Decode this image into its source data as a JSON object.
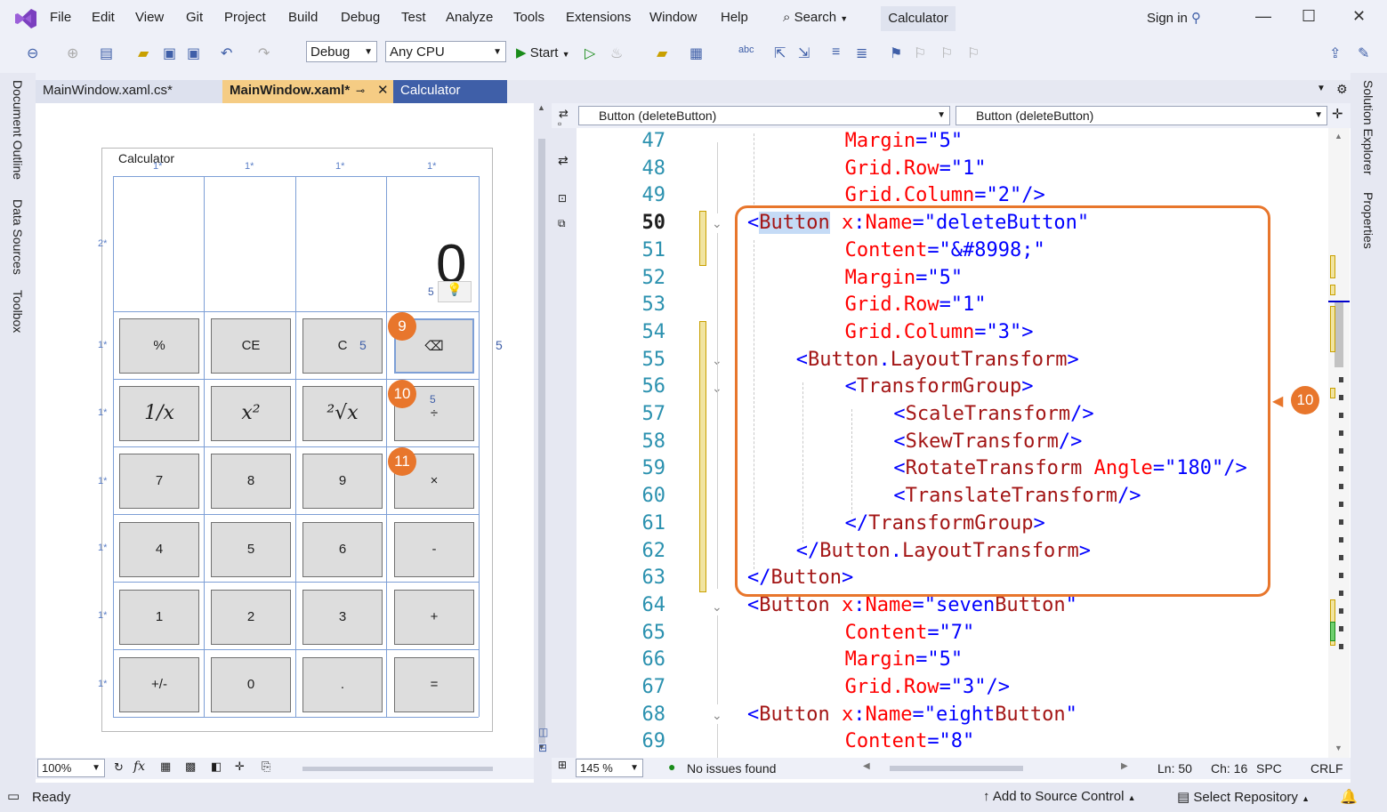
{
  "menubar": {
    "items": [
      "File",
      "Edit",
      "View",
      "Git",
      "Project",
      "Build",
      "Debug",
      "Test",
      "Analyze",
      "Tools",
      "Extensions",
      "Window",
      "Help"
    ],
    "search_label": "Search",
    "solution_title": "Calculator",
    "signin_label": "Sign in"
  },
  "toolbar": {
    "config": "Debug",
    "platform": "Any CPU",
    "start_label": "Start"
  },
  "left_rail": [
    "Document Outline",
    "Data Sources",
    "Toolbox"
  ],
  "right_rail": [
    "Solution Explorer",
    "Properties"
  ],
  "tabs": [
    {
      "label": "MainWindow.xaml.cs*"
    },
    {
      "label": "MainWindow.xaml*"
    },
    {
      "label": "Calculator"
    }
  ],
  "designer": {
    "window_title": "Calculator",
    "display_value": "0",
    "col_labels": [
      "1*",
      "1*",
      "1*",
      "1*"
    ],
    "row_labels": [
      "2*",
      "1*",
      "1*",
      "1*",
      "1*",
      "1*",
      "1*"
    ],
    "margin_labels": [
      "5",
      "5",
      "5",
      "5"
    ],
    "buttons": [
      [
        "%",
        "CE",
        "C",
        "⌫"
      ],
      [
        "1/x",
        "x²",
        "²√x",
        "÷"
      ],
      [
        "7",
        "8",
        "9",
        "×"
      ],
      [
        "4",
        "5",
        "6",
        "-"
      ],
      [
        "1",
        "2",
        "3",
        "+"
      ],
      [
        "+/-",
        "0",
        ".",
        "="
      ]
    ],
    "zoom": "100%",
    "fx_label": "fx"
  },
  "badges": {
    "nine": "9",
    "ten_a": "10",
    "eleven": "11",
    "ten_b": "10"
  },
  "editor": {
    "nav_left": "Button (deleteButton)",
    "nav_right": "Button (deleteButton)",
    "zoom": "145 %",
    "issues": "No issues found",
    "ln": "Ln: 50",
    "ch": "Ch: 16",
    "spc": "SPC",
    "crlf": "CRLF",
    "lines": [
      {
        "n": "47",
        "indent": 8,
        "parts": [
          [
            "a",
            "Margin"
          ],
          [
            "b",
            "=\"5\""
          ]
        ]
      },
      {
        "n": "48",
        "indent": 8,
        "parts": [
          [
            "a",
            "Grid.Row"
          ],
          [
            "b",
            "=\"1\""
          ]
        ]
      },
      {
        "n": "49",
        "indent": 8,
        "parts": [
          [
            "a",
            "Grid.Column"
          ],
          [
            "b",
            "=\"2\"/>"
          ]
        ]
      },
      {
        "n": "50",
        "indent": 0,
        "parts": [
          [
            "b",
            "<"
          ],
          [
            "rh",
            "Button"
          ],
          [
            "x",
            " "
          ],
          [
            "a",
            "x"
          ],
          [
            "b",
            ":"
          ],
          [
            "a",
            "Name"
          ],
          [
            "b",
            "=\"deleteButton\""
          ]
        ]
      },
      {
        "n": "51",
        "indent": 8,
        "parts": [
          [
            "a",
            "Content"
          ],
          [
            "b",
            "=\"&#8998;\""
          ]
        ]
      },
      {
        "n": "52",
        "indent": 8,
        "parts": [
          [
            "a",
            "Margin"
          ],
          [
            "b",
            "=\"5\""
          ]
        ]
      },
      {
        "n": "53",
        "indent": 8,
        "parts": [
          [
            "a",
            "Grid.Row"
          ],
          [
            "b",
            "=\"1\""
          ]
        ]
      },
      {
        "n": "54",
        "indent": 8,
        "parts": [
          [
            "a",
            "Grid.Column"
          ],
          [
            "b",
            "=\"3\">"
          ]
        ]
      },
      {
        "n": "55",
        "indent": 4,
        "parts": [
          [
            "b",
            "<"
          ],
          [
            "r",
            "Button"
          ],
          [
            "b",
            "."
          ],
          [
            "r",
            "LayoutTransform"
          ],
          [
            "b",
            ">"
          ]
        ]
      },
      {
        "n": "56",
        "indent": 8,
        "parts": [
          [
            "b",
            "<"
          ],
          [
            "r",
            "TransformGroup"
          ],
          [
            "b",
            ">"
          ]
        ]
      },
      {
        "n": "57",
        "indent": 12,
        "parts": [
          [
            "b",
            "<"
          ],
          [
            "r",
            "ScaleTransform"
          ],
          [
            "b",
            "/>"
          ]
        ]
      },
      {
        "n": "58",
        "indent": 12,
        "parts": [
          [
            "b",
            "<"
          ],
          [
            "r",
            "SkewTransform"
          ],
          [
            "b",
            "/>"
          ]
        ]
      },
      {
        "n": "59",
        "indent": 12,
        "parts": [
          [
            "b",
            "<"
          ],
          [
            "r",
            "RotateTransform"
          ],
          [
            "x",
            " "
          ],
          [
            "a",
            "Angle"
          ],
          [
            "b",
            "=\"180\"/>"
          ]
        ]
      },
      {
        "n": "60",
        "indent": 12,
        "parts": [
          [
            "b",
            "<"
          ],
          [
            "r",
            "TranslateTransform"
          ],
          [
            "b",
            "/>"
          ]
        ]
      },
      {
        "n": "61",
        "indent": 8,
        "parts": [
          [
            "b",
            "</"
          ],
          [
            "r",
            "TransformGroup"
          ],
          [
            "b",
            ">"
          ]
        ]
      },
      {
        "n": "62",
        "indent": 4,
        "parts": [
          [
            "b",
            "</"
          ],
          [
            "r",
            "Button"
          ],
          [
            "b",
            "."
          ],
          [
            "r",
            "LayoutTransform"
          ],
          [
            "b",
            ">"
          ]
        ]
      },
      {
        "n": "63",
        "indent": 0,
        "parts": [
          [
            "b",
            "</"
          ],
          [
            "r",
            "Button"
          ],
          [
            "b",
            ">"
          ]
        ]
      },
      {
        "n": "64",
        "indent": 0,
        "parts": [
          [
            "b",
            "<"
          ],
          [
            "r",
            "Button"
          ],
          [
            "x",
            " "
          ],
          [
            "a",
            "x"
          ],
          [
            "b",
            ":"
          ],
          [
            "a",
            "Name"
          ],
          [
            "b",
            "=\"seven"
          ],
          [
            "r",
            "Button"
          ],
          [
            "b",
            "\""
          ]
        ]
      },
      {
        "n": "65",
        "indent": 8,
        "parts": [
          [
            "a",
            "Content"
          ],
          [
            "b",
            "=\"7\""
          ]
        ]
      },
      {
        "n": "66",
        "indent": 8,
        "parts": [
          [
            "a",
            "Margin"
          ],
          [
            "b",
            "=\"5\""
          ]
        ]
      },
      {
        "n": "67",
        "indent": 8,
        "parts": [
          [
            "a",
            "Grid.Row"
          ],
          [
            "b",
            "=\"3\"/>"
          ]
        ]
      },
      {
        "n": "68",
        "indent": 0,
        "parts": [
          [
            "b",
            "<"
          ],
          [
            "r",
            "Button"
          ],
          [
            "x",
            " "
          ],
          [
            "a",
            "x"
          ],
          [
            "b",
            ":"
          ],
          [
            "a",
            "Name"
          ],
          [
            "b",
            "=\"eight"
          ],
          [
            "r",
            "Button"
          ],
          [
            "b",
            "\""
          ]
        ]
      },
      {
        "n": "69",
        "indent": 8,
        "parts": [
          [
            "a",
            "Content"
          ],
          [
            "b",
            "=\"8\""
          ]
        ]
      }
    ]
  },
  "status": {
    "ready": "Ready",
    "source_control": "Add to Source Control",
    "repository": "Select Repository"
  },
  "colors": {
    "accent_orange": "#e8762c",
    "vs_purple": "#7b3fbf",
    "tag_blue": "#0000ff",
    "element_red": "#a31515",
    "attr_red": "#ff0000"
  },
  "icons": [
    "vs-logo-icon",
    "search-icon",
    "add-person-icon",
    "minimize-icon",
    "maximize-icon",
    "close-icon",
    "start-play-icon",
    "bell-icon"
  ]
}
